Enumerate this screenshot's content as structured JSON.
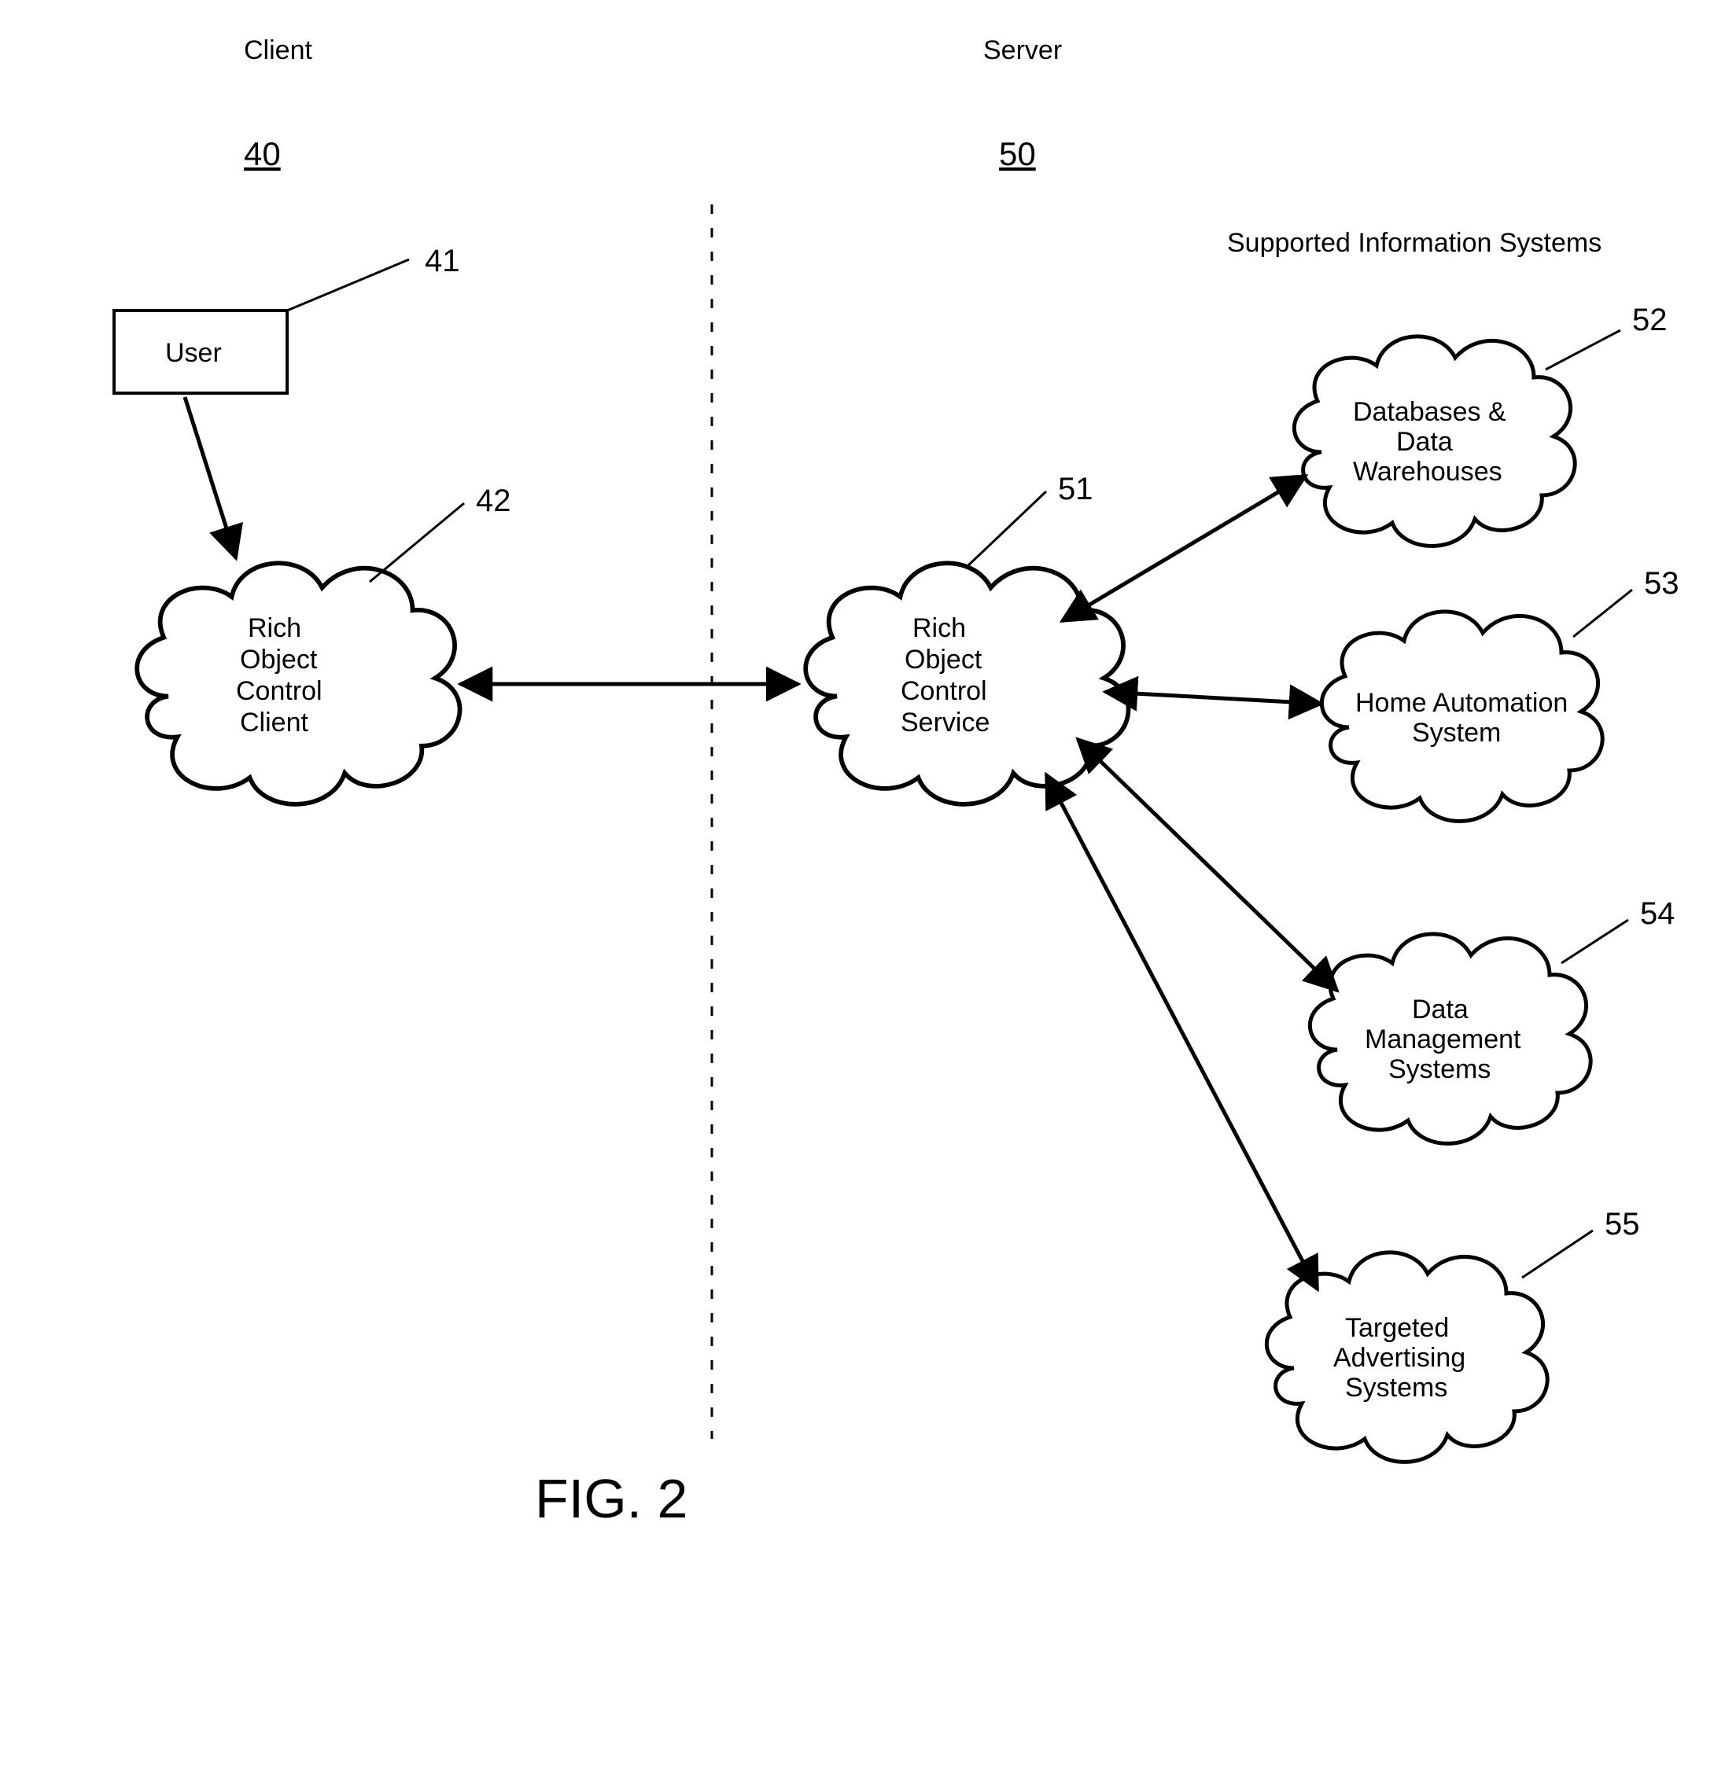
{
  "headers": {
    "client": "Client",
    "server": "Server",
    "client_ref": "40",
    "server_ref": "50",
    "supported_info_systems": "Supported Information Systems"
  },
  "figure_caption": "FIG. 2",
  "nodes": {
    "user": {
      "ref": "41",
      "label": "User"
    },
    "roc_client": {
      "ref": "42",
      "lines": [
        "Rich",
        "Object",
        "Control",
        "Client"
      ]
    },
    "roc_service": {
      "ref": "51",
      "lines": [
        "Rich",
        "Object",
        "Control",
        "Service"
      ]
    },
    "databases": {
      "ref": "52",
      "lines": [
        "Databases &",
        "Data",
        "Warehouses"
      ]
    },
    "home_automation": {
      "ref": "53",
      "lines": [
        "Home Automation",
        "System"
      ]
    },
    "data_mgmt": {
      "ref": "54",
      "lines": [
        "Data",
        "Management",
        "Systems"
      ]
    },
    "targeted_ads": {
      "ref": "55",
      "lines": [
        "Targeted",
        "Advertising",
        "Systems"
      ]
    }
  }
}
